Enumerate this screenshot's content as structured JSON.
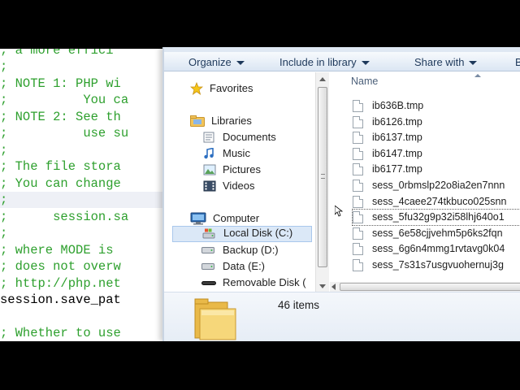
{
  "editor": {
    "lines": [
      "; a more effici",
      ";",
      "; NOTE 1: PHP wi",
      ";          You ca",
      "; NOTE 2: See th",
      ";          use su",
      ";",
      "; The file stora",
      "; You can change",
      ";",
      ";      session.sa",
      ";",
      "; where MODE is ",
      "; does not overw",
      "; http://php.net",
      "session.save_pat",
      "",
      "; Whether to use"
    ]
  },
  "explorer": {
    "toolbar": {
      "organize": "Organize",
      "include_in_library": "Include in library",
      "share_with": "Share with",
      "edge_letter": "B"
    },
    "nav": {
      "favorites": "Favorites",
      "libraries": "Libraries",
      "documents": "Documents",
      "music": "Music",
      "pictures": "Pictures",
      "videos": "Videos",
      "computer": "Computer",
      "local_disk": "Local Disk (C:)",
      "backup": "Backup (D:)",
      "data": "Data (E:)",
      "removable": "Removable Disk ("
    },
    "files": {
      "column_name": "Name",
      "items": [
        "ib636B.tmp",
        "ib6126.tmp",
        "ib6137.tmp",
        "ib6147.tmp",
        "ib6177.tmp",
        "sess_0rbmslp22o8ia2en7nnn",
        "sess_4caee274tkbuco025snn",
        "sess_5fu32g9p32i58lhj640o1",
        "sess_6e58cjjvehm5p6ks2fqn",
        "sess_6g6n4mmg1rvtavg0k04",
        "sess_7s31s7usgvuohernuj3g"
      ],
      "selected_index": 7
    },
    "details": {
      "item_count": "46 items"
    }
  },
  "colors": {
    "comment_green": "#2ea02e",
    "nav_selected": "#dbe8f7",
    "toolbar_text": "#1e395b"
  }
}
